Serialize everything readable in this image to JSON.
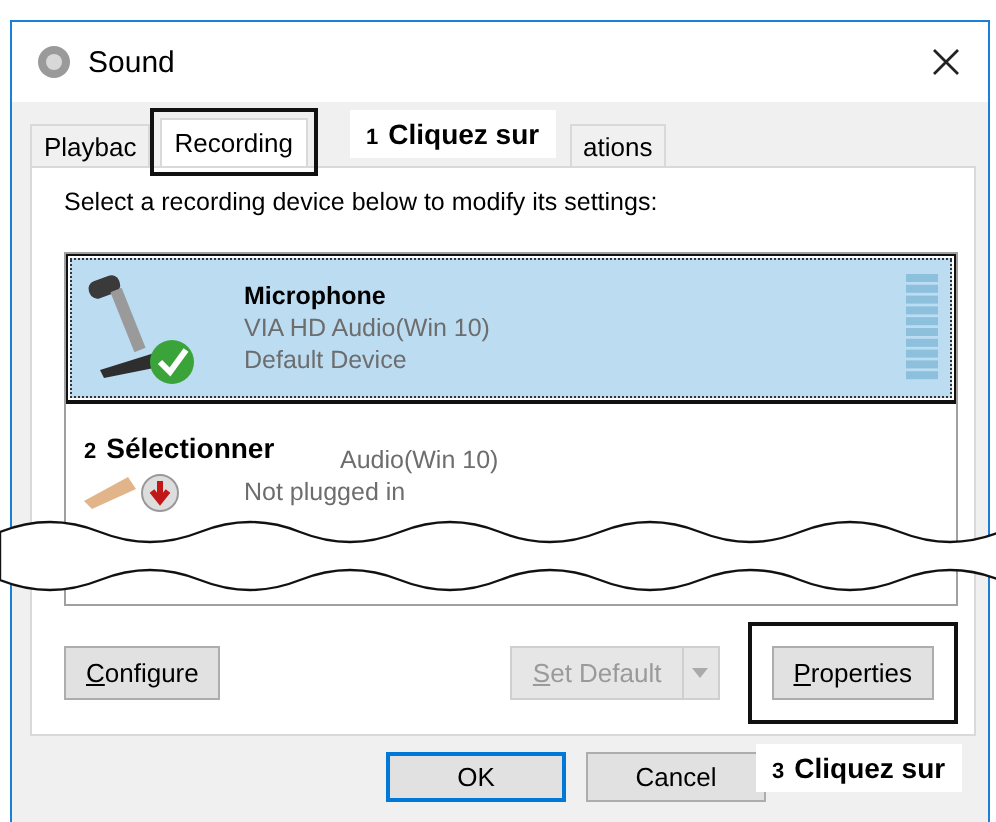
{
  "window": {
    "title": "Sound"
  },
  "tabs": [
    {
      "label": "Playbac",
      "selected": false,
      "highlighted": false
    },
    {
      "label": "Recording",
      "selected": true,
      "highlighted": true
    },
    {
      "label": "ations",
      "selected": false,
      "highlighted": false
    }
  ],
  "instruction": "Select a recording device below to modify its settings:",
  "devices": [
    {
      "kind": "microphone",
      "name": "Microphone",
      "driver": "VIA HD Audio(Win 10)",
      "status": "Default Device",
      "selected": true,
      "default": true,
      "highlighted": true
    },
    {
      "kind": "line",
      "driver": "Audio(Win 10)",
      "status": "Not plugged in",
      "selected": false,
      "default": false,
      "highlighted": false
    }
  ],
  "buttons": [
    {
      "label": "Configure",
      "underline_first": true,
      "disabled": false,
      "split": false,
      "highlighted": false
    },
    {
      "label": "Set Default",
      "underline_first": true,
      "disabled": true,
      "split": true,
      "highlighted": false
    },
    {
      "label": "Properties",
      "underline_first": true,
      "disabled": false,
      "split": false,
      "highlighted": true
    }
  ],
  "dialog_buttons": [
    {
      "label": "OK",
      "default": true
    },
    {
      "label": "Cancel",
      "default": false
    }
  ],
  "callouts": [
    {
      "number": "1",
      "text": "Cliquez sur"
    },
    {
      "number": "2",
      "text": "Sélectionner"
    },
    {
      "number": "3",
      "text": "Cliquez sur"
    }
  ]
}
